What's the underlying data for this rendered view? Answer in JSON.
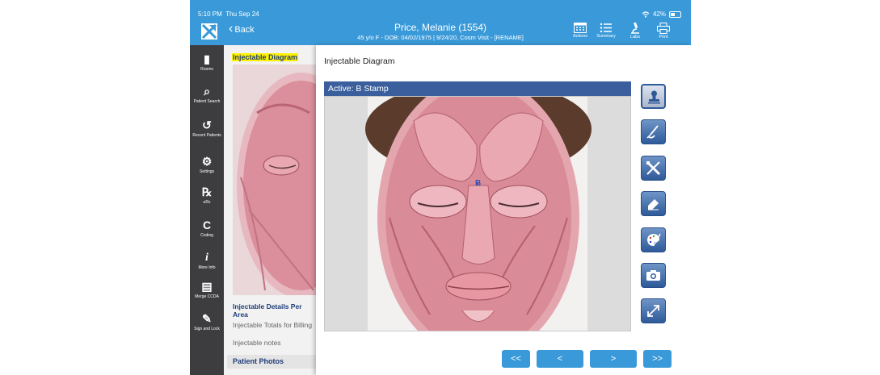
{
  "status_bar": {
    "time": "5:10 PM",
    "date": "Thu Sep 24",
    "battery": "42%"
  },
  "header": {
    "back_label": "Back",
    "patient_name": "Price, Melanie (1554)",
    "patient_details": "45 y/o F - DOB: 04/02/1975 | 9/24/20, Cosm Visit - [RENAME]",
    "buttons": [
      {
        "label": "Actions",
        "icon": "calendar-grid-icon"
      },
      {
        "label": "Summary",
        "icon": "list-icon"
      },
      {
        "label": "Labs",
        "icon": "microscope-icon"
      },
      {
        "label": "Print",
        "icon": "printer-icon"
      }
    ],
    "color": "#3a9ad9"
  },
  "sidebar": {
    "items": [
      {
        "label": "Rooms",
        "icon": "door-icon"
      },
      {
        "label": "Patient Search",
        "icon": "magnifier-icon"
      },
      {
        "label": "Recent Patients",
        "icon": "history-icon"
      },
      {
        "label": "Settings",
        "icon": "gear-icon"
      },
      {
        "label": "eRx",
        "icon": "rx-icon"
      },
      {
        "label": "Coding",
        "icon": "c-icon"
      },
      {
        "label": "More Info",
        "icon": "info-icon"
      },
      {
        "label": "Merge CCDA",
        "icon": "clipboard-icon"
      },
      {
        "label": "Sign and Lock",
        "icon": "pen-icon"
      }
    ]
  },
  "document": {
    "highlight_title": "Injectable Diagram",
    "links": [
      "Injectable Details Per Area",
      "Injectable Totals for Billing",
      "Injectable notes"
    ],
    "section": "Patient Photos"
  },
  "modal": {
    "title": "Injectable Diagram",
    "active_label": "Active: B Stamp",
    "stamp_label": "B",
    "tools": [
      {
        "name": "stamp-icon",
        "selected": true
      },
      {
        "name": "pen-icon",
        "selected": false
      },
      {
        "name": "cross-tools-icon",
        "selected": false
      },
      {
        "name": "eraser-icon",
        "selected": false
      },
      {
        "name": "palette-icon",
        "selected": false
      },
      {
        "name": "camera-icon",
        "selected": false
      },
      {
        "name": "expand-icon",
        "selected": false
      }
    ],
    "nav": [
      "<<",
      "<",
      ">",
      ">>"
    ]
  }
}
